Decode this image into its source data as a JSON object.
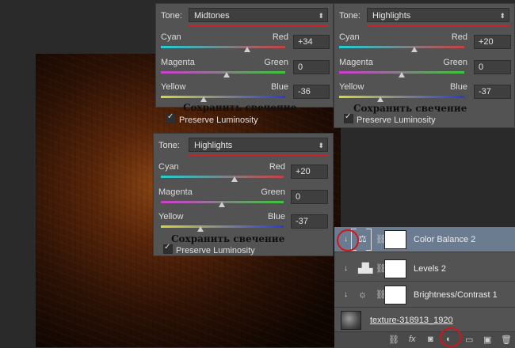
{
  "panels": [
    {
      "id": "midtones",
      "tone_label": "Tone:",
      "tone_value": "Midtones",
      "sliders": [
        {
          "left": "Cyan",
          "right": "Red",
          "value": "+34",
          "level": 0.67
        },
        {
          "left": "Magenta",
          "right": "Green",
          "value": "0",
          "level": 0.5
        },
        {
          "left": "Yellow",
          "right": "Blue",
          "value": "-36",
          "level": 0.32
        }
      ],
      "ru_text": "Сохранить свечение",
      "preserve_label": "Preserve Luminosity"
    },
    {
      "id": "highlights-right",
      "tone_label": "Tone:",
      "tone_value": "Highlights",
      "sliders": [
        {
          "left": "Cyan",
          "right": "Red",
          "value": "+20",
          "level": 0.6
        },
        {
          "left": "Magenta",
          "right": "Green",
          "value": "0",
          "level": 0.5
        },
        {
          "left": "Yellow",
          "right": "Blue",
          "value": "-37",
          "level": 0.32
        }
      ],
      "ru_text": "Сохранить свечение",
      "preserve_label": "Preserve Luminosity"
    },
    {
      "id": "highlights-center",
      "tone_label": "Tone:",
      "tone_value": "Highlights",
      "sliders": [
        {
          "left": "Cyan",
          "right": "Red",
          "value": "+20",
          "level": 0.6
        },
        {
          "left": "Magenta",
          "right": "Green",
          "value": "0",
          "level": 0.5
        },
        {
          "left": "Yellow",
          "right": "Blue",
          "value": "-37",
          "level": 0.32
        }
      ],
      "ru_text": "Сохранить свечение",
      "preserve_label": "Preserve Luminosity"
    }
  ],
  "layers": [
    {
      "name": "Color Balance 2",
      "icon": "color-balance-icon",
      "selected": true
    },
    {
      "name": "Levels 2",
      "icon": "levels-icon",
      "selected": false
    },
    {
      "name": "Brightness/Contrast 1",
      "icon": "brightness-icon",
      "selected": false
    },
    {
      "name": "texture-318913_1920",
      "icon": "image-thumbnail",
      "selected": false
    }
  ],
  "layers_bar": {
    "fx_label": "fx",
    "icons": [
      "link-icon",
      "fx-icon",
      "mask-icon",
      "adjustment-icon",
      "folder-icon",
      "new-layer-icon",
      "trash-icon"
    ]
  },
  "colors": {
    "panel_bg": "#535353",
    "tone_underline": "#c8242a",
    "selected_layer": "#6b7b90",
    "annotation_red": "#d3141c"
  }
}
